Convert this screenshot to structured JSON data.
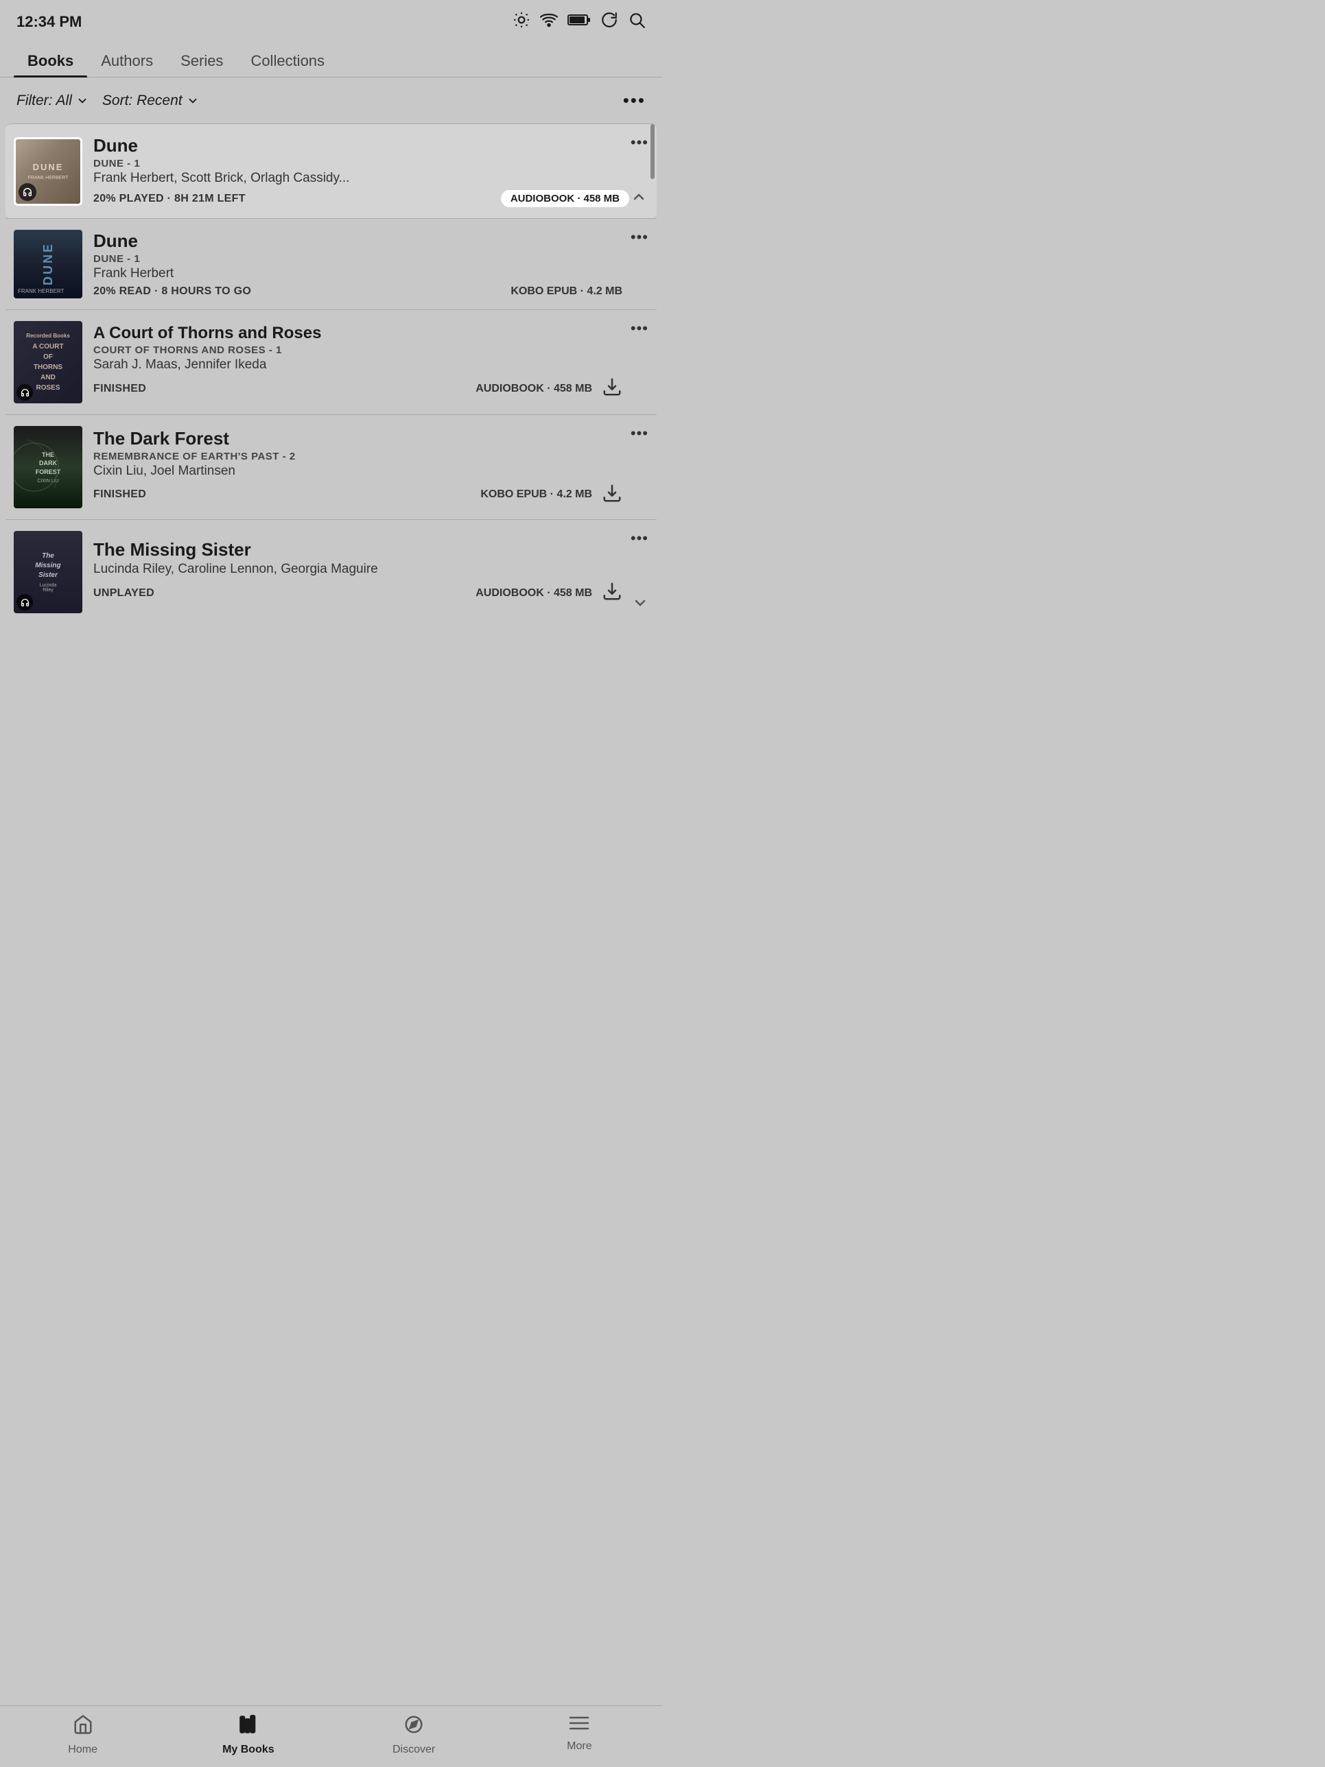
{
  "statusBar": {
    "time": "12:34 PM"
  },
  "tabs": {
    "items": [
      {
        "label": "Books",
        "active": true
      },
      {
        "label": "Authors",
        "active": false
      },
      {
        "label": "Series",
        "active": false
      },
      {
        "label": "Collections",
        "active": false
      }
    ]
  },
  "filterBar": {
    "filter": "Filter: All",
    "sort": "Sort: Recent",
    "moreLabel": "•••"
  },
  "books": [
    {
      "id": "dune-audio",
      "title": "Dune",
      "series": "DUNE - 1",
      "authors": "Frank Herbert, Scott Brick, Orlagh Cassidy...",
      "progress": "20% PLAYED · 8H 21M LEFT",
      "formatBadge": "AUDIOBOOK · 458 MB",
      "badgeStyle": "pill",
      "coverType": "dune-audio",
      "hasHeadphone": true,
      "hasDownload": false,
      "hasCollapse": true
    },
    {
      "id": "dune-epub",
      "title": "Dune",
      "series": "DUNE - 1",
      "authors": "Frank Herbert",
      "progress": "20% READ · 8 HOURS TO GO",
      "formatBadge": "KOBO EPUB · 4.2 MB",
      "badgeStyle": "plain",
      "coverType": "dune-epub",
      "hasHeadphone": false,
      "hasDownload": false,
      "hasCollapse": false
    },
    {
      "id": "acotar",
      "title": "A Court of Thorns and Roses",
      "series": "COURT OF THORNS AND ROSES - 1",
      "authors": "Sarah J. Maas, Jennifer Ikeda",
      "progress": "FINISHED",
      "formatBadge": "AUDIOBOOK · 458 MB",
      "badgeStyle": "plain",
      "coverType": "acotar",
      "hasHeadphone": true,
      "hasDownload": true,
      "hasCollapse": false
    },
    {
      "id": "darkforest",
      "title": "The Dark Forest",
      "series": "REMEMBRANCE OF EARTH'S PAST - 2",
      "authors": "Cixin Liu, Joel Martinsen",
      "progress": "FINISHED",
      "formatBadge": "KOBO EPUB · 4.2 MB",
      "badgeStyle": "plain",
      "coverType": "darkforest",
      "hasHeadphone": false,
      "hasDownload": true,
      "hasCollapse": false
    },
    {
      "id": "missingsister",
      "title": "The Missing Sister",
      "series": "",
      "authors": "Lucinda Riley, Caroline Lennon, Georgia Maguire",
      "progress": "UNPLAYED",
      "formatBadge": "AUDIOBOOK · 458 MB",
      "badgeStyle": "plain",
      "coverType": "missingsister",
      "hasHeadphone": true,
      "hasDownload": true,
      "hasCollapse": false
    }
  ],
  "bottomNav": {
    "items": [
      {
        "label": "Home",
        "active": false,
        "icon": "home"
      },
      {
        "label": "My Books",
        "active": true,
        "icon": "books"
      },
      {
        "label": "Discover",
        "active": false,
        "icon": "discover"
      },
      {
        "label": "More",
        "active": false,
        "icon": "more"
      }
    ]
  }
}
